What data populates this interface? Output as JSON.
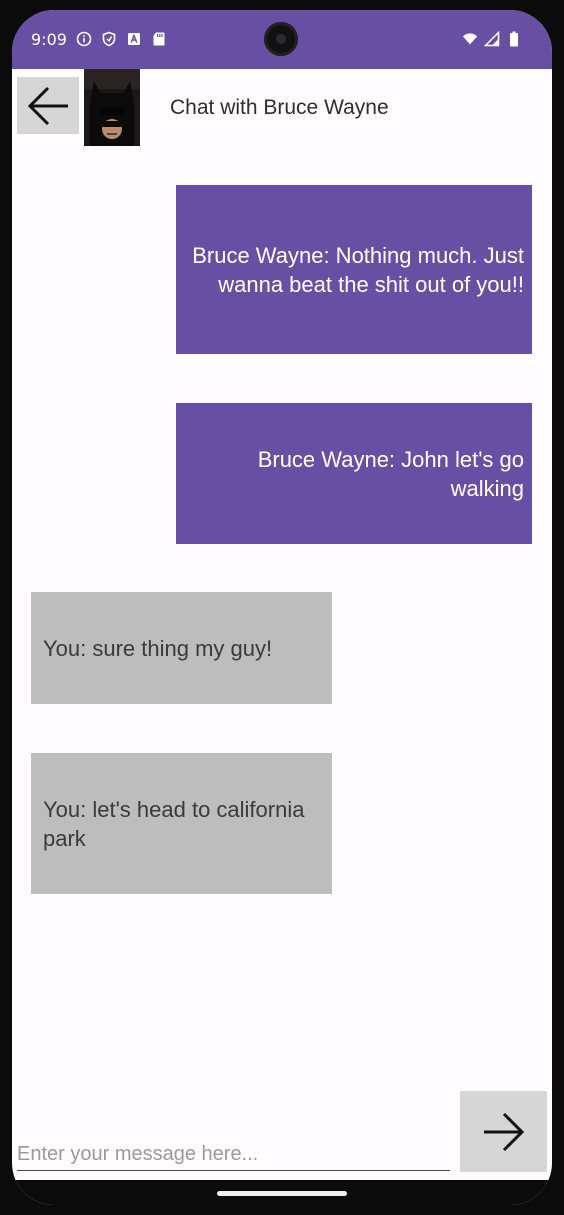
{
  "status_bar": {
    "time": "9:09",
    "icons_left": [
      "info-icon",
      "shield-icon",
      "font-a-icon",
      "sd-card-icon"
    ],
    "icons_right": [
      "wifi-icon",
      "signal-icon",
      "battery-icon"
    ],
    "color": "#6750a4"
  },
  "header": {
    "back_icon": "arrow-left-icon",
    "avatar": "avatar",
    "title": "Chat with Bruce Wayne"
  },
  "messages": [
    {
      "sender": "received",
      "text": "Bruce Wayne: Nothing much. Just wanna beat the shit out of you!!"
    },
    {
      "sender": "received",
      "text": "Bruce Wayne: John let's go walking"
    },
    {
      "sender": "sent",
      "text": "You: sure thing my guy!"
    },
    {
      "sender": "sent",
      "text": "You: let's head to california park"
    }
  ],
  "composer": {
    "placeholder": "Enter your message here...",
    "value": "",
    "send_icon": "arrow-right-icon"
  },
  "colors": {
    "accent": "#6750a4",
    "received_bubble": "#6750a4",
    "sent_bubble": "#bdbdbd",
    "background": "#fffbfe",
    "button_bg": "#d6d6d6"
  }
}
